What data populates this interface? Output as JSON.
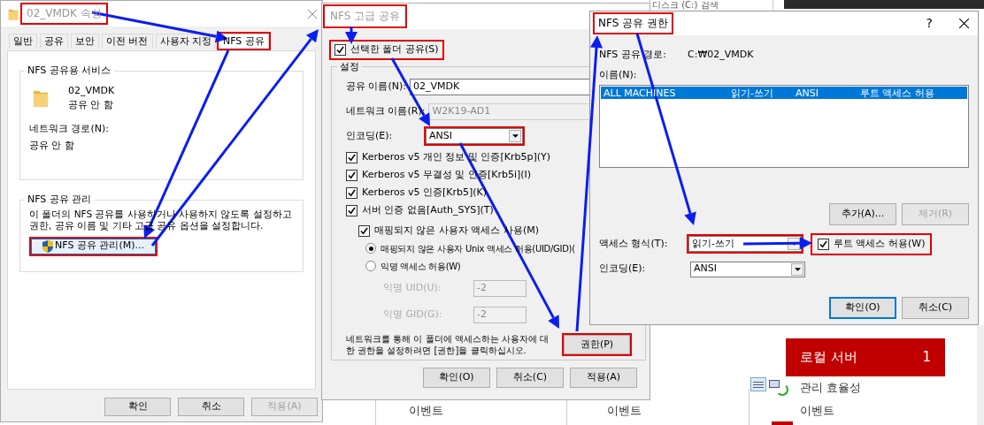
{
  "desktop": {
    "search_placeholder": "디스크 (C:) 검색",
    "column_headers": [
      "이벤트",
      "이벤트"
    ],
    "tile": {
      "title": "로컬 서버",
      "count": "1"
    },
    "tile_items": [
      "관리 효율성",
      "이벤트"
    ]
  },
  "properties_window": {
    "title": {
      "text": "02_VMDK 속성",
      "highlighted": true
    },
    "tabs": [
      {
        "label": "일반",
        "selected": false,
        "highlighted": false
      },
      {
        "label": "공유",
        "selected": false,
        "highlighted": false
      },
      {
        "label": "보안",
        "selected": false,
        "highlighted": false
      },
      {
        "label": "이전 버전",
        "selected": false,
        "highlighted": false
      },
      {
        "label": "사용자 지정",
        "selected": false,
        "highlighted": false
      },
      {
        "label": "NFS 공유",
        "selected": true,
        "highlighted": true
      }
    ],
    "service_group": {
      "title": "NFS 공유용 서비스",
      "folder_name": "02_VMDK",
      "folder_status": "공유 안 함",
      "path_label": "네트워크 경로(N):",
      "path_value": "공유 안 함"
    },
    "manage_group": {
      "title": "NFS 공유 관리",
      "description": "이 폴더의 NFS 공유를 사용하거나 사용하지 않도록 설정하고 권한, 공유 이름 및 기타 고급 공유 옵션을 설정합니다.",
      "button": {
        "label": "NFS 공유 관리(M)...",
        "highlighted": true
      }
    },
    "buttons": [
      {
        "label": "확인",
        "disabled": false
      },
      {
        "label": "취소",
        "disabled": false
      },
      {
        "label": "적용(A)",
        "disabled": true
      }
    ]
  },
  "advanced_window": {
    "title": {
      "text": "NFS 고급 공유",
      "highlighted": true
    },
    "share_checkbox": {
      "label": "선택한 폴더 공유(S)",
      "checked": true,
      "highlighted": true
    },
    "group_title": "설정",
    "fields": [
      {
        "label": "공유 이름(N):",
        "value": "02_VMDK",
        "disabled": false
      },
      {
        "label": "네트워크 이름(R):",
        "value": "W2K19-AD1",
        "disabled": true
      }
    ],
    "encoding": {
      "label": "인코딩(E):",
      "value": "ANSI",
      "highlighted": true
    },
    "auth_options": [
      {
        "label": "Kerberos v5 개인 정보 및 인증[Krb5p](Y)",
        "checked": true
      },
      {
        "label": "Kerberos v5 무결성 및 인증[Krb5i](I)",
        "checked": true
      },
      {
        "label": "Kerberos v5 인증[Krb5](K)",
        "checked": true
      },
      {
        "label": "서버 인증 없음[Auth_SYS](T)",
        "checked": true
      }
    ],
    "unmapped": {
      "label": "매핑되지 않은 사용자 액세스 사용(M)",
      "checked": true
    },
    "unmapped_modes": [
      {
        "label": "매핑되지 않은 사용자 Unix 액세스 허용(UID/GID)(",
        "selected": true
      },
      {
        "label": "익명 액세스 허용(W)",
        "selected": false
      }
    ],
    "anonymous_ids": [
      {
        "label": "익명 UID(U):",
        "value": "-2",
        "disabled": true
      },
      {
        "label": "익명 GID(G):",
        "value": "-2",
        "disabled": true
      }
    ],
    "note": "네트워크를 통해 이 폴더에 액세스하는 사용자에 대한 권한을 설정하려면 [권한]을 클릭하십시오.",
    "permissions_button": {
      "label": "권한(P)",
      "highlighted": true
    },
    "buttons": [
      "확인(O)",
      "취소(C)",
      "적용(A)"
    ]
  },
  "permissions_window": {
    "title": {
      "text": "NFS 공유 권한",
      "highlighted": true
    },
    "help": "?",
    "path_label": "NFS 공유 경로:",
    "path_value": "C:₩02_VMDK",
    "list_label": "이름(N):",
    "rows": [
      {
        "cells": [
          "ALL MACHINES",
          "읽기-쓰기",
          "ANSI",
          "루트 액세스 허용"
        ],
        "selected": true
      }
    ],
    "list_buttons": [
      {
        "label": "추가(A)...",
        "disabled": false
      },
      {
        "label": "제거(R)",
        "disabled": true
      }
    ],
    "access_type": {
      "label": "액세스 형식(T):",
      "value": "읽기-쓰기",
      "highlighted": true
    },
    "root_access": {
      "label": "루트 액세스 허용(W)",
      "checked": true,
      "highlighted": true
    },
    "encoding": {
      "label": "인코딩(E):",
      "value": "ANSI"
    },
    "buttons": [
      {
        "label": "확인(O)",
        "default": true
      },
      {
        "label": "취소(C)",
        "default": false
      }
    ]
  }
}
